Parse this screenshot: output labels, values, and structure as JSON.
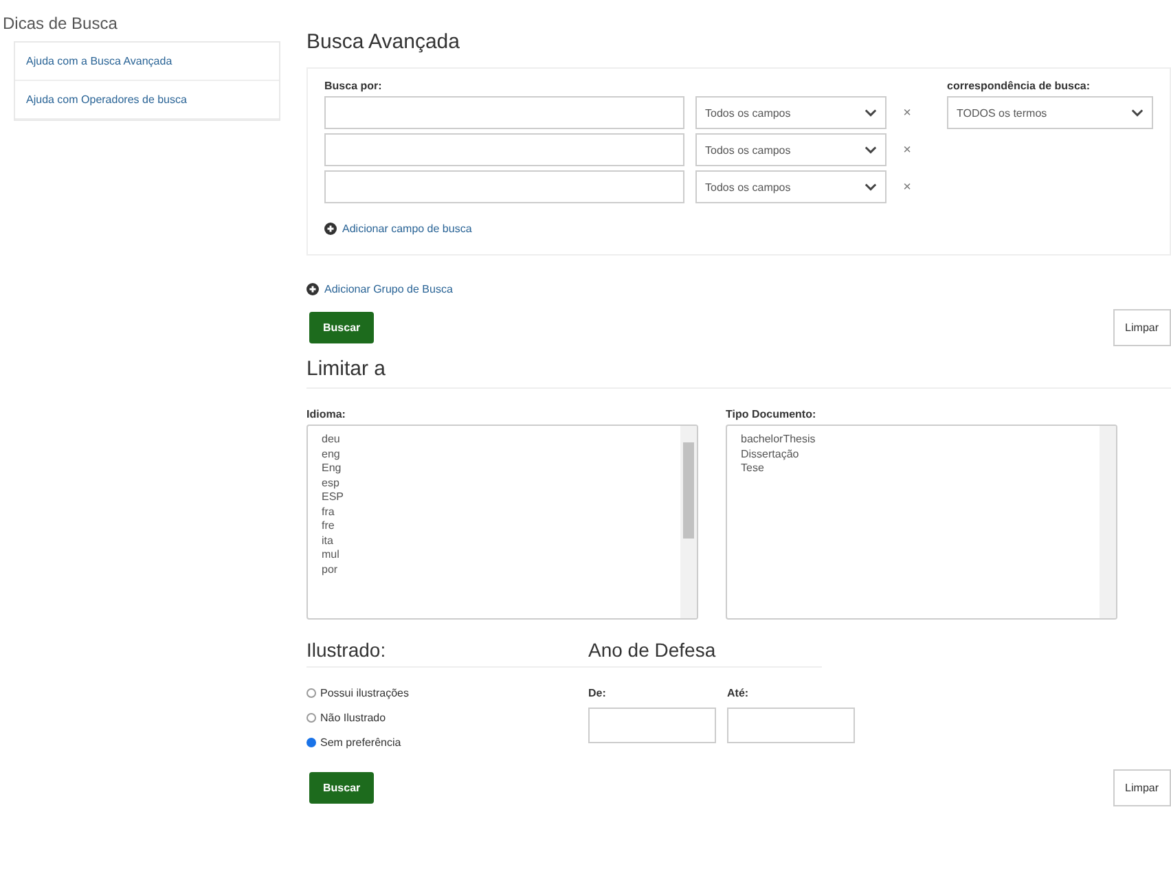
{
  "sidebar": {
    "title": "Dicas de Busca",
    "items": [
      {
        "label": "Ajuda com a Busca Avançada"
      },
      {
        "label": "Ajuda com Operadores de busca"
      }
    ]
  },
  "advanced_search": {
    "title": "Busca Avançada",
    "search_label": "Busca por:",
    "rows": [
      {
        "value": "",
        "field": "Todos os campos",
        "remove": "×"
      },
      {
        "value": "",
        "field": "Todos os campos",
        "remove": "×"
      },
      {
        "value": "",
        "field": "Todos os campos",
        "remove": "×"
      }
    ],
    "match_label": "correspondência de busca:",
    "match_value": "TODOS os termos",
    "add_field": "Adicionar campo de busca",
    "add_group": "Adicionar Grupo de Busca",
    "search_button": "Buscar",
    "clear_button": "Limpar"
  },
  "limit": {
    "title": "Limitar a",
    "language_label": "Idioma:",
    "languages": [
      "deu",
      "eng",
      "Eng",
      "esp",
      "ESP",
      "fra",
      "fre",
      "ita",
      "mul",
      "por"
    ],
    "doc_type_label": "Tipo Documento:",
    "doc_types": [
      "bachelorThesis",
      "Dissertação",
      "Tese"
    ]
  },
  "illustrated": {
    "title": "Ilustrado:",
    "options": [
      {
        "label": "Possui ilustrações",
        "selected": false
      },
      {
        "label": "Não Ilustrado",
        "selected": false
      },
      {
        "label": "Sem preferência",
        "selected": true
      }
    ]
  },
  "defense_year": {
    "title": "Ano de Defesa",
    "from_label": "De:",
    "to_label": "Até:"
  },
  "footer": {
    "search_button": "Buscar",
    "clear_button": "Limpar"
  }
}
